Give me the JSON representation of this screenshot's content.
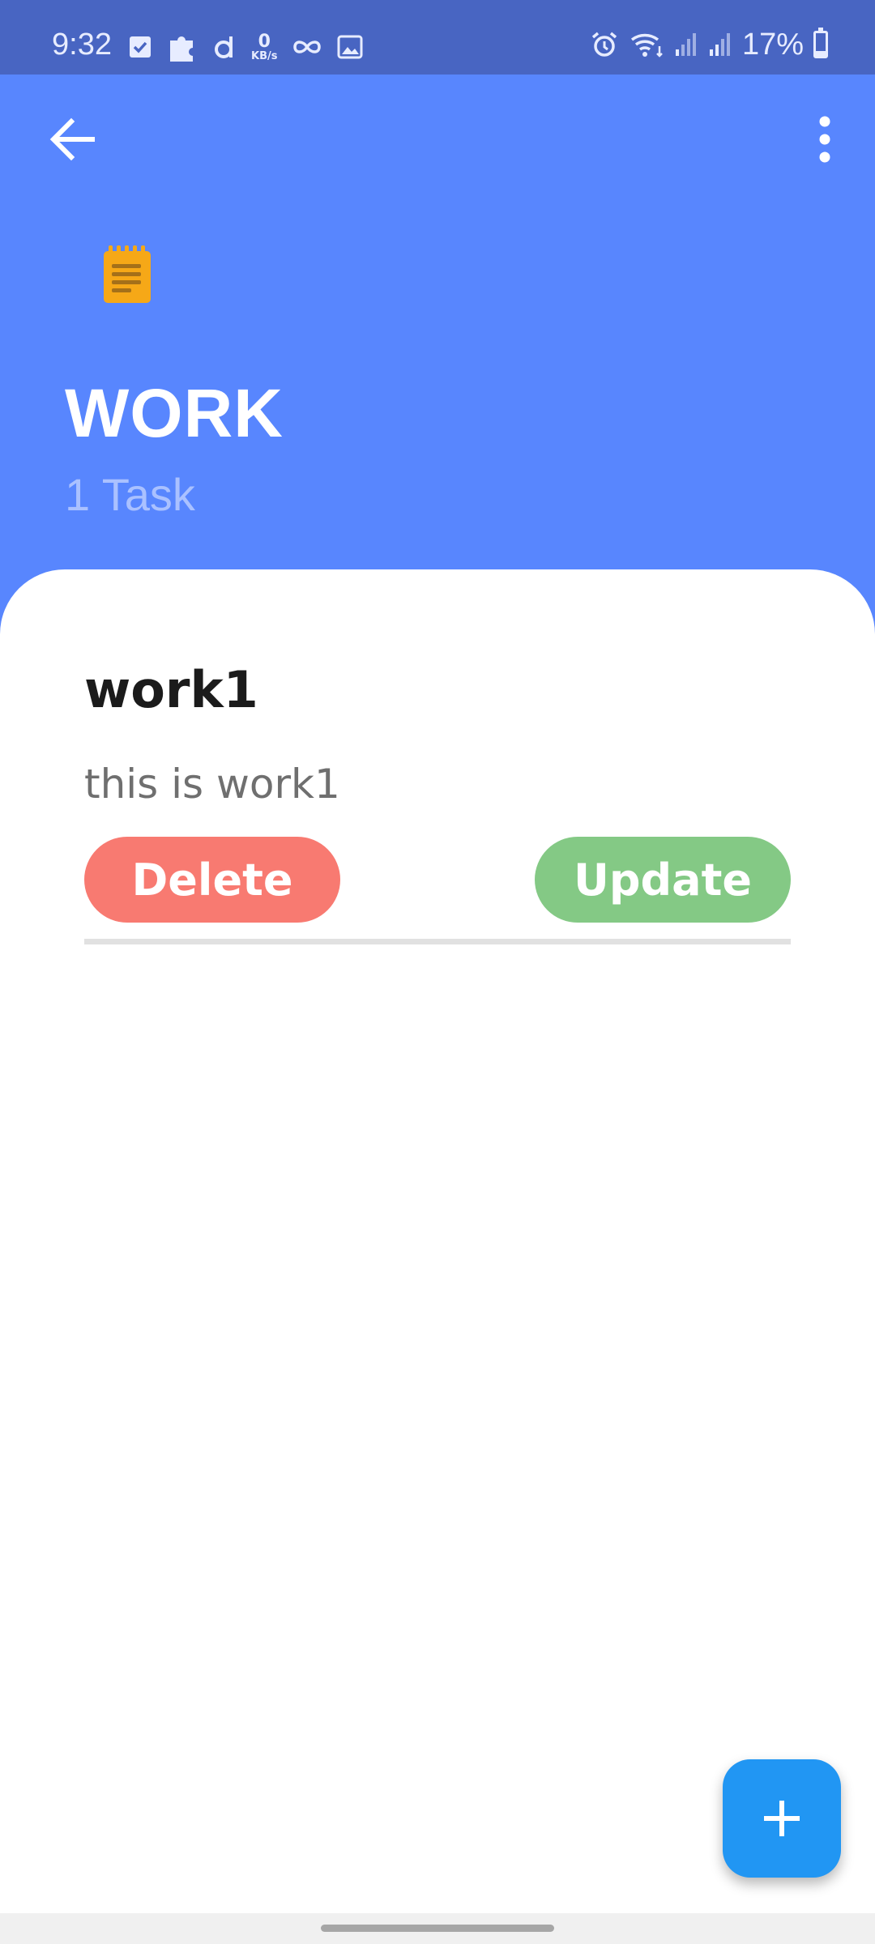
{
  "status_bar": {
    "time": "9:32",
    "net_speed": "0",
    "net_unit": "KB/s",
    "battery_text": "17%",
    "battery_level": 0.17,
    "icons": [
      "checkbox-icon",
      "puzzle-icon",
      "d-app-icon",
      "net-speed-icon",
      "infinity-icon",
      "image-icon",
      "alarm-icon",
      "wifi-icon",
      "signal-icon",
      "signal-icon",
      "battery-icon"
    ]
  },
  "header": {
    "back_icon": "arrow-left-icon",
    "more_icon": "more-vert-icon",
    "category_icon": "note-icon",
    "title": "WORK",
    "subtitle": "1 Task",
    "colors": {
      "background": "#5886fe",
      "status_bar": "#4865c2",
      "icon_accent": "#f6a817"
    }
  },
  "tasks": [
    {
      "title": "work1",
      "description": "this is work1",
      "delete_label": "Delete",
      "update_label": "Update"
    }
  ],
  "colors": {
    "delete": "#f87a71",
    "update": "#84c985",
    "fab": "#2196f3"
  },
  "fab": {
    "icon": "plus-icon"
  }
}
